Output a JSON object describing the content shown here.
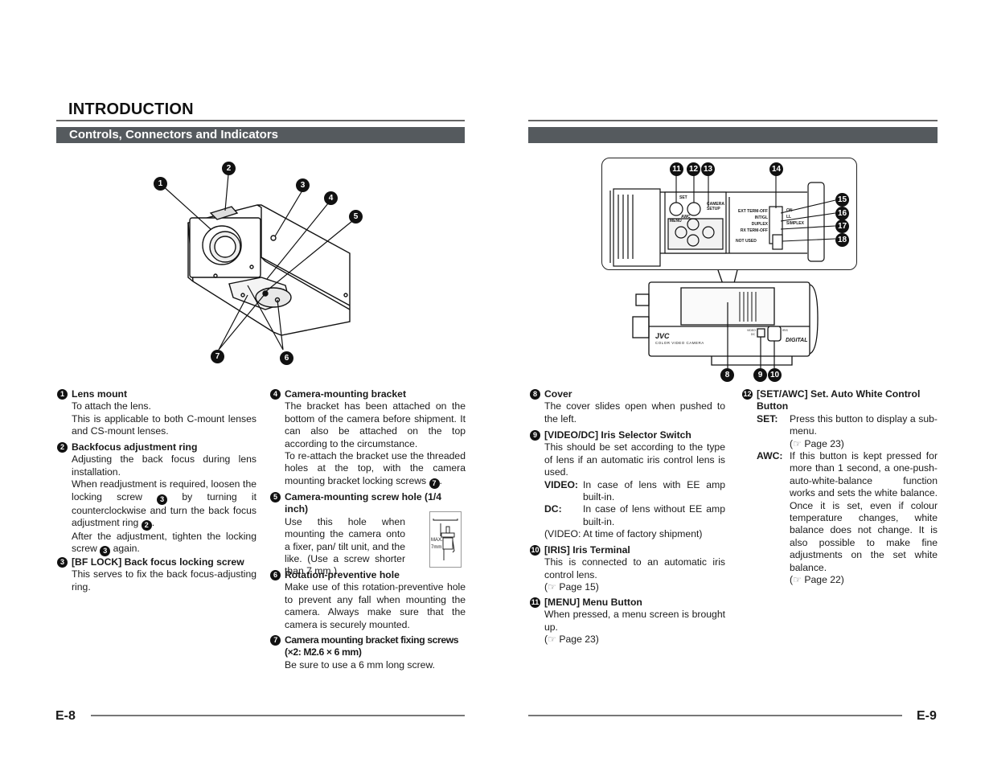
{
  "header": {
    "title": "INTRODUCTION",
    "section": "Controls, Connectors and Indicators"
  },
  "footer": {
    "left_page": "E-8",
    "right_page": "E-9"
  },
  "figures": {
    "front_callouts": [
      "1",
      "2",
      "3",
      "4",
      "5",
      "6",
      "7"
    ],
    "rear_callouts": [
      "8",
      "9",
      "10",
      "11",
      "12",
      "13",
      "14",
      "15",
      "16",
      "17",
      "18"
    ],
    "panel_labels": {
      "set": "SET",
      "awc": "AWC",
      "menu": "MENU",
      "camera_setup": "CAMERA SETUP",
      "ext_term": "EXT TERM-OFF",
      "intgl": "INT/GL",
      "duplex": "DUPLEX",
      "rx_term": "RX TERM-OFF",
      "not_used": "NOT USED",
      "on": "ON",
      "ll": "LL",
      "simplex": "SIMPLEX",
      "on2": "ON"
    },
    "body_labels": {
      "brand": "JVC",
      "model": "COLOR VIDEO CAMERA",
      "digital": "DIGITAL",
      "video": "VIDEO",
      "dc": "DC",
      "iris": "IRIS"
    },
    "screw_inset": {
      "max": "MAX.",
      "length": "7mm"
    }
  },
  "items": [
    {
      "num": "1",
      "title": "Lens mount",
      "paras": [
        "To attach the lens.",
        "This is applicable to both C-mount lenses and CS-mount lenses."
      ]
    },
    {
      "num": "2",
      "title": "Backfocus adjustment ring",
      "paras": [
        "Adjusting the back focus during lens installation.",
        "When readjustment is required, loosen the locking screw",
        "by turning it counterclockwise and turn the back focus adjustment ring",
        "After the adjustment, tighten the locking screw",
        "again."
      ]
    },
    {
      "num": "3",
      "title": "[BF LOCK] Back focus locking screw",
      "paras": [
        "This serves to fix the back focus-adjusting ring."
      ]
    },
    {
      "num": "4",
      "title": "Camera-mounting bracket",
      "paras": [
        "The bracket has been attached on the bottom of the camera before shipment. It can also be attached on the top according to the circumstance.",
        "To re-attach the bracket use the threaded holes at the top, with the camera mounting bracket locking screws"
      ]
    },
    {
      "num": "5",
      "title": "Camera-mounting screw hole (1/4 inch)",
      "paras": [
        "Use this hole when mounting the camera onto a fixer, pan/ tilt unit, and the like. (Use a screw shorter than 7 mm.)"
      ]
    },
    {
      "num": "6",
      "title": "Rotation-preventive hole",
      "paras": [
        "Make use of this rotation-preventive hole to prevent any fall when mounting the camera.  Always make sure that the camera is securely mounted."
      ]
    },
    {
      "num": "7",
      "title": "Camera mounting bracket fixing screws (×2: M2.6 × 6 mm)",
      "paras": [
        "Be sure to use a 6 mm long screw."
      ]
    },
    {
      "num": "8",
      "title": "Cover",
      "paras": [
        "The cover slides open when pushed to the left."
      ]
    },
    {
      "num": "9",
      "title": "[VIDEO/DC] Iris Selector Switch",
      "paras": [
        "This should be set according to the type of lens if an automatic iris control lens is used."
      ],
      "options": [
        {
          "key": "VIDEO:",
          "value": "In case of lens with EE amp built-in."
        },
        {
          "key": "DC:",
          "value": "In case of lens without EE amp built-in."
        }
      ],
      "note": "(VIDEO:  At time of factory shipment)"
    },
    {
      "num": "10",
      "title": "[IRIS] Iris Terminal",
      "paras": [
        "This is connected to an automatic iris control lens."
      ],
      "ref": "Page 15"
    },
    {
      "num": "11",
      "title": "[MENU] Menu Button",
      "paras": [
        "When pressed, a menu screen is brought up."
      ],
      "ref": "Page 23"
    },
    {
      "num": "12",
      "title": "[SET/AWC] Set. Auto White Control Button",
      "options": [
        {
          "key": "SET:",
          "value": "Press this button to display a sub-menu.",
          "ref": "Page 23"
        },
        {
          "key": "AWC:",
          "value": "If this button is kept pressed for more than 1 second, a one-push-auto-white-balance function works and sets the white balance.  Once it is set, even if colour temperature changes, white balance does not change. It is also possible to make fine adjustments on the set white balance.",
          "ref": "Page 22"
        }
      ]
    }
  ],
  "ref_icon": "pointing-hand-icon",
  "ref_glyph": "☞"
}
